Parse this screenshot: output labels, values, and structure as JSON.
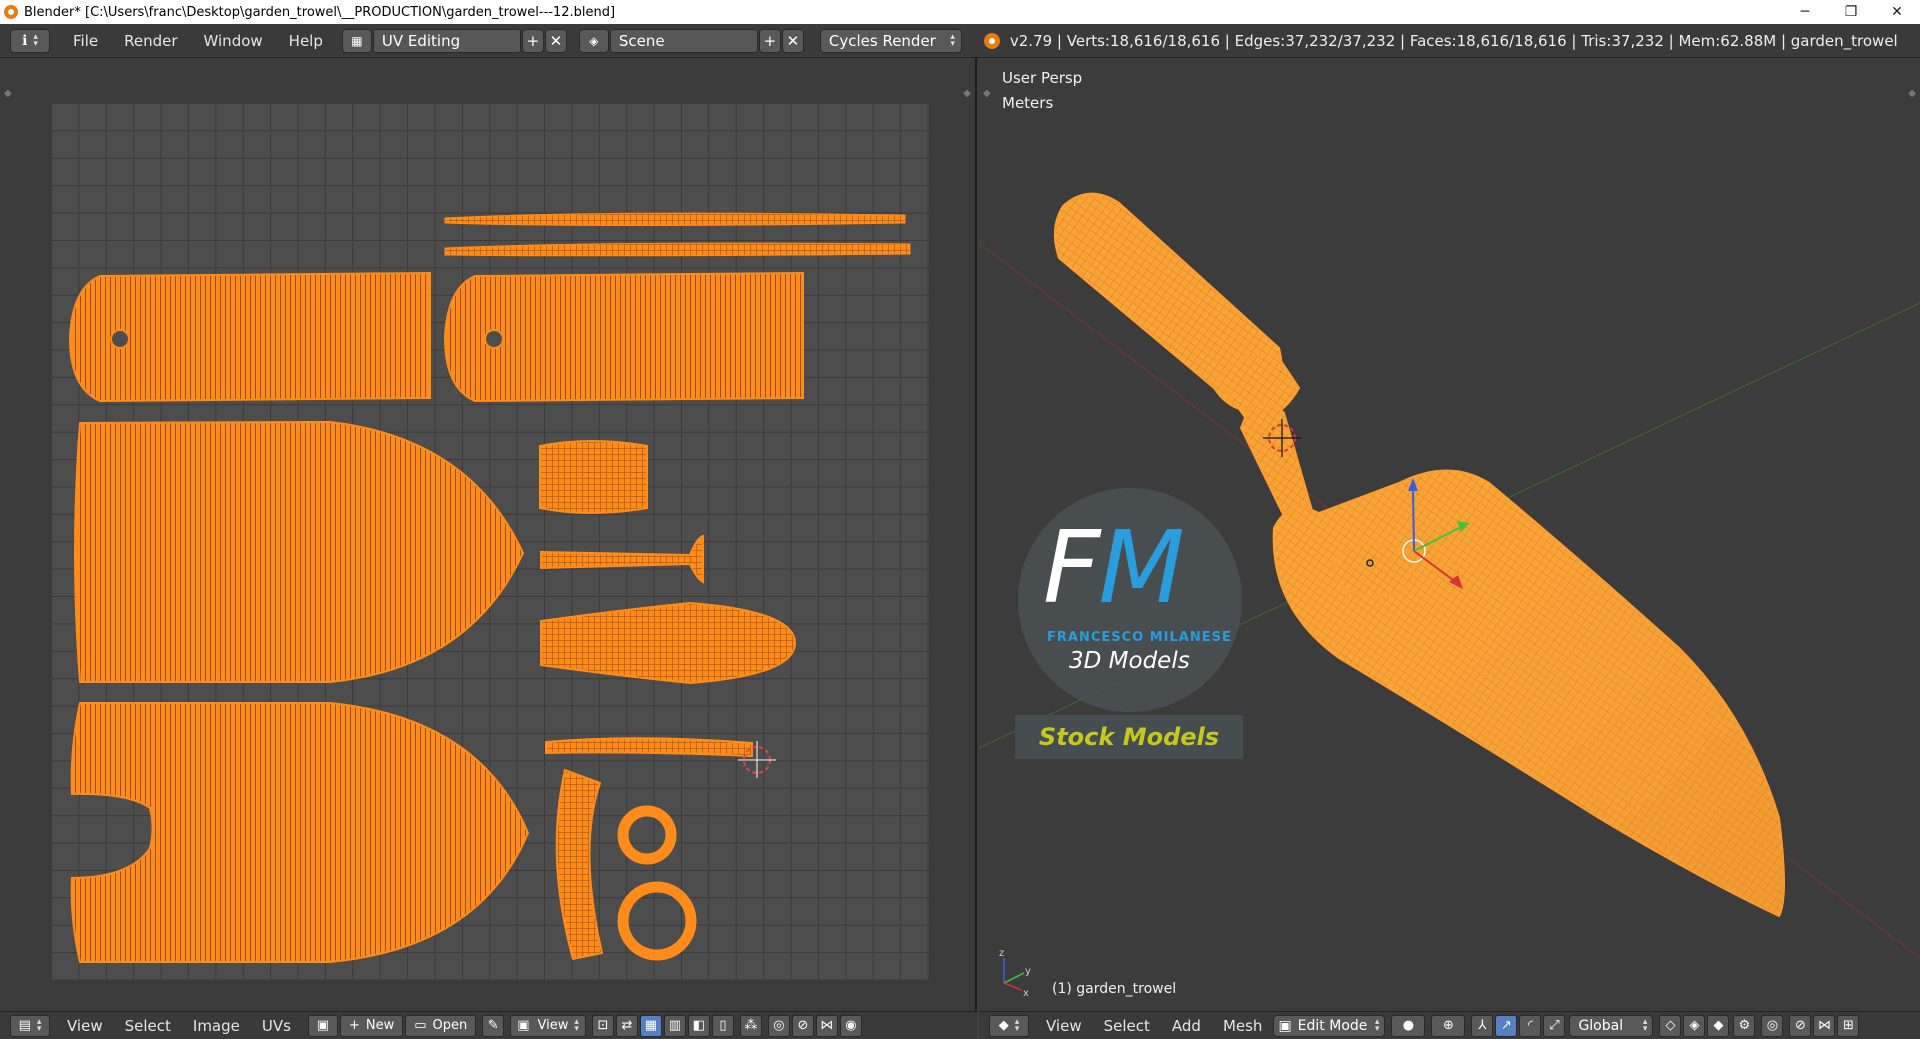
{
  "window": {
    "title": "Blender* [C:\\Users\\franc\\Desktop\\garden_trowel\\__PRODUCTION\\garden_trowel---12.blend]",
    "minimize": "─",
    "restore": "❐",
    "close": "✕"
  },
  "topbar": {
    "info_icon": "ℹ",
    "menus": [
      "File",
      "Render",
      "Window",
      "Help"
    ],
    "screen_layout": "UV Editing",
    "scene": "Scene",
    "render_engine": "Cycles Render",
    "stats": "v2.79 | Verts:18,616/18,616 | Edges:37,232/37,232 | Faces:18,616/18,616 | Tris:37,232 | Mem:62.88M | garden_trowel"
  },
  "viewport": {
    "view_name": "User Persp",
    "units": "Meters",
    "object_label": "(1) garden_trowel"
  },
  "watermark": {
    "logo_letters": "FM",
    "brand": "FRANCESCO MILANESE",
    "tagline": "3D Models",
    "banner": "Stock Models"
  },
  "uv_bottombar": {
    "menus": [
      "View",
      "Select",
      "Image",
      "UVs"
    ],
    "new_label": "New",
    "open_label": "Open",
    "view_label": "View"
  },
  "vp_bottombar": {
    "menus": [
      "View",
      "Select",
      "Add",
      "Mesh"
    ],
    "mode": "Edit Mode",
    "orientation": "Global"
  },
  "colors": {
    "mesh": "#ff8c1a",
    "accent": "#5680c2",
    "bg": "#3d3d3d"
  }
}
